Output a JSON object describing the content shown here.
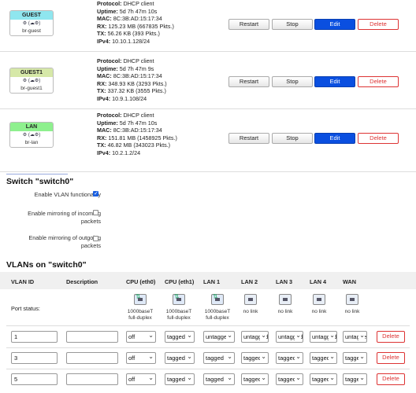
{
  "interfaces": [
    {
      "name": "GUEST",
      "device": "br-guest",
      "badge_color": "#8fe6ef",
      "icons": "⚙ (☁⚙)",
      "protocol": "DHCP client",
      "uptime": "5d 7h 47m 10s",
      "mac": "8C:3B:AD:15:17:34",
      "rx": "125.23 MB (667835 Pkts.)",
      "tx": "56.26 KB (393 Pkts.)",
      "ipv4": "10.10.1.128/24"
    },
    {
      "name": "GUEST1",
      "device": "br-guest1",
      "badge_color": "#d6e8a8",
      "icons": "⚙ (☁⚙)",
      "protocol": "DHCP client",
      "uptime": "5d 7h 47m 9s",
      "mac": "8C:3B:AD:15:17:34",
      "rx": "348.93 KB (3293 Pkts.)",
      "tx": "337.32 KB (3555 Pkts.)",
      "ipv4": "10.9.1.108/24"
    },
    {
      "name": "LAN",
      "device": "br-lan",
      "badge_color": "#8ef08e",
      "icons": "⚙ (☁⚙)",
      "protocol": "DHCP client",
      "uptime": "5d 7h 47m 10s",
      "mac": "8C:3B:AD:15:17:34",
      "rx": "151.81 MB (1458925 Pkts.)",
      "tx": "46.82 MB (343023 Pkts.)",
      "ipv4": "10.2.1.2/24"
    }
  ],
  "field_labels": {
    "protocol": "Protocol:",
    "uptime": "Uptime:",
    "mac": "MAC:",
    "rx": "RX:",
    "tx": "TX:",
    "ipv4": "IPv4:"
  },
  "buttons": {
    "restart": "Restart",
    "stop": "Stop",
    "edit": "Edit",
    "delete": "Delete"
  },
  "switch": {
    "title": "Switch \"switch0\"",
    "options": [
      {
        "label_lines": [
          "Enable VLAN functionality"
        ],
        "checked": true
      },
      {
        "label_lines": [
          "Enable mirroring of incoming",
          "packets"
        ],
        "checked": false
      },
      {
        "label_lines": [
          "Enable mirroring of outgoing",
          "packets"
        ],
        "checked": false
      }
    ]
  },
  "vlans": {
    "title": "VLANs on \"switch0\"",
    "headers": [
      "VLAN ID",
      "Description",
      "CPU (eth0)",
      "CPU (eth1)",
      "LAN 1",
      "LAN 2",
      "LAN 3",
      "LAN 4",
      "WAN"
    ],
    "port_status_label": "Port status:",
    "ports": [
      {
        "line1": "1000baseT",
        "line2": "full-duplex",
        "up": true
      },
      {
        "line1": "1000baseT",
        "line2": "full-duplex",
        "up": true
      },
      {
        "line1": "1000baseT",
        "line2": "full-duplex",
        "up": true
      },
      {
        "line1": "no link",
        "line2": "",
        "up": false
      },
      {
        "line1": "no link",
        "line2": "",
        "up": false
      },
      {
        "line1": "no link",
        "line2": "",
        "up": false
      },
      {
        "line1": "no link",
        "line2": "",
        "up": false
      }
    ],
    "rows": [
      {
        "id": "1",
        "description": "",
        "ports": [
          "off",
          "tagged",
          "untagged",
          "untagged",
          "untagged",
          "untagged",
          "untagged"
        ]
      },
      {
        "id": "3",
        "description": "",
        "ports": [
          "off",
          "tagged",
          "tagged",
          "tagged",
          "tagged",
          "tagged",
          "tagged"
        ]
      },
      {
        "id": "5",
        "description": "",
        "ports": [
          "off",
          "tagged",
          "tagged",
          "tagged",
          "tagged",
          "tagged",
          "tagged"
        ]
      }
    ],
    "delete_label": "Delete"
  }
}
